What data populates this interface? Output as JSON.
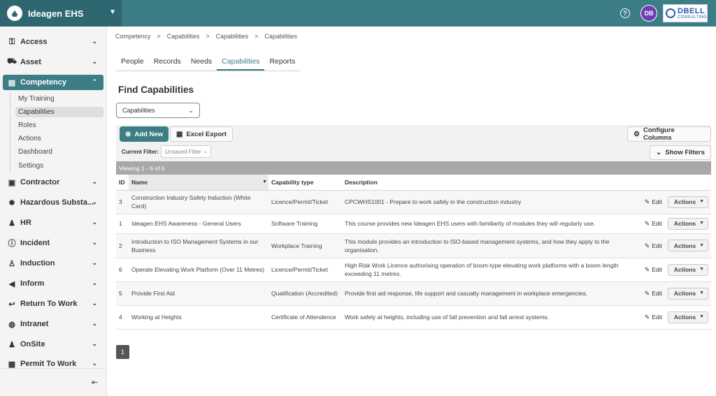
{
  "app": {
    "name": "Ideagen EHS",
    "user_initials": "DB",
    "company_logo_text": "DBELL",
    "company_logo_sub": "CONSULTING",
    "help_glyph": "?"
  },
  "sidebar": {
    "items": [
      {
        "label": "Access",
        "icon": "key-icon",
        "glyph": "⚿"
      },
      {
        "label": "Asset",
        "icon": "truck-icon",
        "glyph": "⛟"
      },
      {
        "label": "Competency",
        "icon": "certificate-icon",
        "glyph": "▤",
        "active": true
      },
      {
        "label": "Contractor",
        "icon": "id-card-icon",
        "glyph": "▣"
      },
      {
        "label": "Hazardous Substa...",
        "icon": "hazard-icon",
        "glyph": "✹"
      },
      {
        "label": "HR",
        "icon": "people-icon",
        "glyph": "♟"
      },
      {
        "label": "Incident",
        "icon": "alert-circle-icon",
        "glyph": "ⓘ"
      },
      {
        "label": "Induction",
        "icon": "person-badge-icon",
        "glyph": "♙"
      },
      {
        "label": "Inform",
        "icon": "megaphone-icon",
        "glyph": "◀"
      },
      {
        "label": "Return To Work",
        "icon": "return-arrow-icon",
        "glyph": "↩"
      },
      {
        "label": "Intranet",
        "icon": "globe-icon",
        "glyph": "◍"
      },
      {
        "label": "OnSite",
        "icon": "worker-icon",
        "glyph": "♟"
      },
      {
        "label": "Permit To Work",
        "icon": "permit-icon",
        "glyph": "▦"
      }
    ],
    "sub_items": [
      {
        "label": "My Training"
      },
      {
        "label": "Capabilities",
        "active": true
      },
      {
        "label": "Roles"
      },
      {
        "label": "Actions"
      },
      {
        "label": "Dashboard"
      },
      {
        "label": "Settings"
      }
    ],
    "collapse_glyph": "⇤"
  },
  "breadcrumb": [
    "Competency",
    "Capabilities",
    "Capabilities",
    "Capabilities"
  ],
  "breadcrumb_sep": ">",
  "tabs": [
    {
      "label": "People"
    },
    {
      "label": "Records"
    },
    {
      "label": "Needs"
    },
    {
      "label": "Capabilities",
      "active": true
    },
    {
      "label": "Reports"
    }
  ],
  "page_title": "Find Capabilities",
  "type_select": {
    "value": "Capabilities"
  },
  "toolbar": {
    "add_new": "Add New",
    "excel_export": "Excel Export",
    "configure_columns": "Configure Columns",
    "show_filters": "Show Filters",
    "current_filter_label": "Current Filter:",
    "current_filter_value": "Unsaved Filter"
  },
  "viewing_text": "Viewing 1 - 6 of 6",
  "table": {
    "columns": [
      "ID",
      "Name",
      "Capability type",
      "Description"
    ],
    "edit_label": "Edit",
    "actions_label": "Actions",
    "rows": [
      {
        "id": "3",
        "name": "Construction Industry Safety Induction (White Card)",
        "type": "Licence/Permit/Ticket",
        "description": "CPCWHS1001 - Prepare to work safely in the construction industry"
      },
      {
        "id": "1",
        "name": "Ideagen EHS Awareness - General Users",
        "type": "Software Training",
        "description": "This course provides new Ideagen EHS users with familiarity of modules they will regularly use."
      },
      {
        "id": "2",
        "name": "Introduction to ISO Management Systems in our Business",
        "type": "Workplace Training",
        "description": "This module provides an introduction to ISO-based management systems, and how they apply to the organisation."
      },
      {
        "id": "6",
        "name": "Operate Elevating Work Platform (Over 11 Metres)",
        "type": "Licence/Permit/Ticket",
        "description": "High Risk Work Licence authorising operation of boom-type elevating work platforms with a boom length exceeding 11 metres."
      },
      {
        "id": "5",
        "name": "Provide First Aid",
        "type": "Qualification (Accredited)",
        "description": "Provide first aid response, life support and casualty management in workplace emergencies."
      },
      {
        "id": "4",
        "name": "Working at Heights",
        "type": "Certificate of Attendence",
        "description": "Work safely at heights, including use of fall prevention and fall arrest systems."
      }
    ]
  },
  "pagination": {
    "current": "1"
  }
}
